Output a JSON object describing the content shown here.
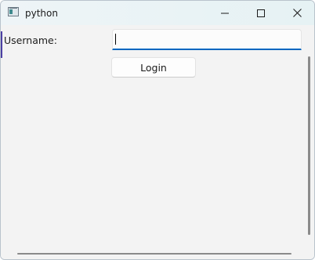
{
  "window": {
    "title": "python",
    "controls": {
      "minimize_icon": "minimize-icon",
      "maximize_icon": "maximize-icon",
      "close_icon": "close-icon"
    }
  },
  "form": {
    "username_label": "Username:",
    "username_value": "",
    "login_label": "Login"
  },
  "colors": {
    "accent": "#0067c0",
    "window_bg": "#f3f3f3",
    "focus_edge": "#4c3fa3"
  }
}
